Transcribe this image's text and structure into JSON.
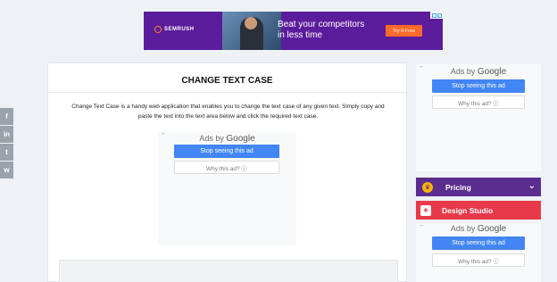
{
  "top_ad": {
    "brand": "SEMRUSH",
    "headline_line1": "Beat your competitors",
    "headline_line2": "in less time",
    "cta": "Try It Free"
  },
  "card": {
    "title": "CHANGE TEXT CASE",
    "description": "Change Text Case is a handy web application that enables you to change the text case of any given text. Simply copy and paste the text into the text area below and click the required text case."
  },
  "ads": {
    "ads_by": "Ads by",
    "google": "Google",
    "stop": "Stop seeing this ad",
    "why": "Why this ad? ⓘ",
    "back_arrow": "←"
  },
  "social": {
    "icons": [
      "facebook-icon",
      "linkedin-icon",
      "twitter-icon",
      "whatsapp-icon"
    ],
    "glyphs": [
      "f",
      "in",
      "t",
      "w"
    ]
  },
  "sidebar": {
    "pricing_label": "Pricing",
    "pricing_icon": "crown-icon",
    "pricing_chevron": "⌄",
    "studio_label": "Design Studio",
    "studio_icon": "design-studio-icon"
  },
  "colors": {
    "pricing_bg": "#5b2d8e",
    "studio_bg": "#e8394a",
    "stop_button": "#4285f4",
    "ad_bg": "#5b1c9c",
    "cta_bg": "#ff6a2a"
  }
}
